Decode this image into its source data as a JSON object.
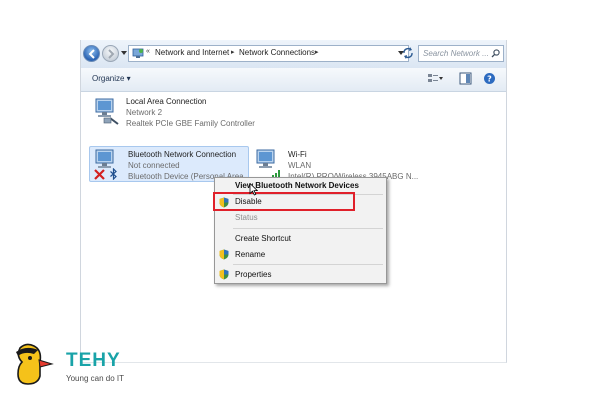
{
  "addressbar": {
    "crumbs": [
      "Network and Internet",
      "Network Connections"
    ],
    "search_placeholder": "Search Network ..."
  },
  "toolbar": {
    "organize_label": "Organize ▾"
  },
  "connections": [
    {
      "name": "Local Area Connection",
      "status": "Network  2",
      "device": "Realtek PCIe GBE Family Controller"
    },
    {
      "name": "Bluetooth Network Connection",
      "status": "Not connected",
      "device": "Bluetooth Device (Personal Area"
    },
    {
      "name": "Wi-Fi",
      "status": "WLAN",
      "device": "Intel(R) PRO/Wireless 3945ABG N..."
    }
  ],
  "context_menu": {
    "items": [
      "View Bluetooth Network Devices",
      "Disable",
      "Status",
      "Create Shortcut",
      "Rename",
      "Properties"
    ]
  },
  "watermark": {
    "brand": "TEHY",
    "tagline": "Young can do IT"
  },
  "colors": {
    "accent": "#2a63b3",
    "highlight": "#e0202a",
    "brand": "#19a3a8"
  }
}
